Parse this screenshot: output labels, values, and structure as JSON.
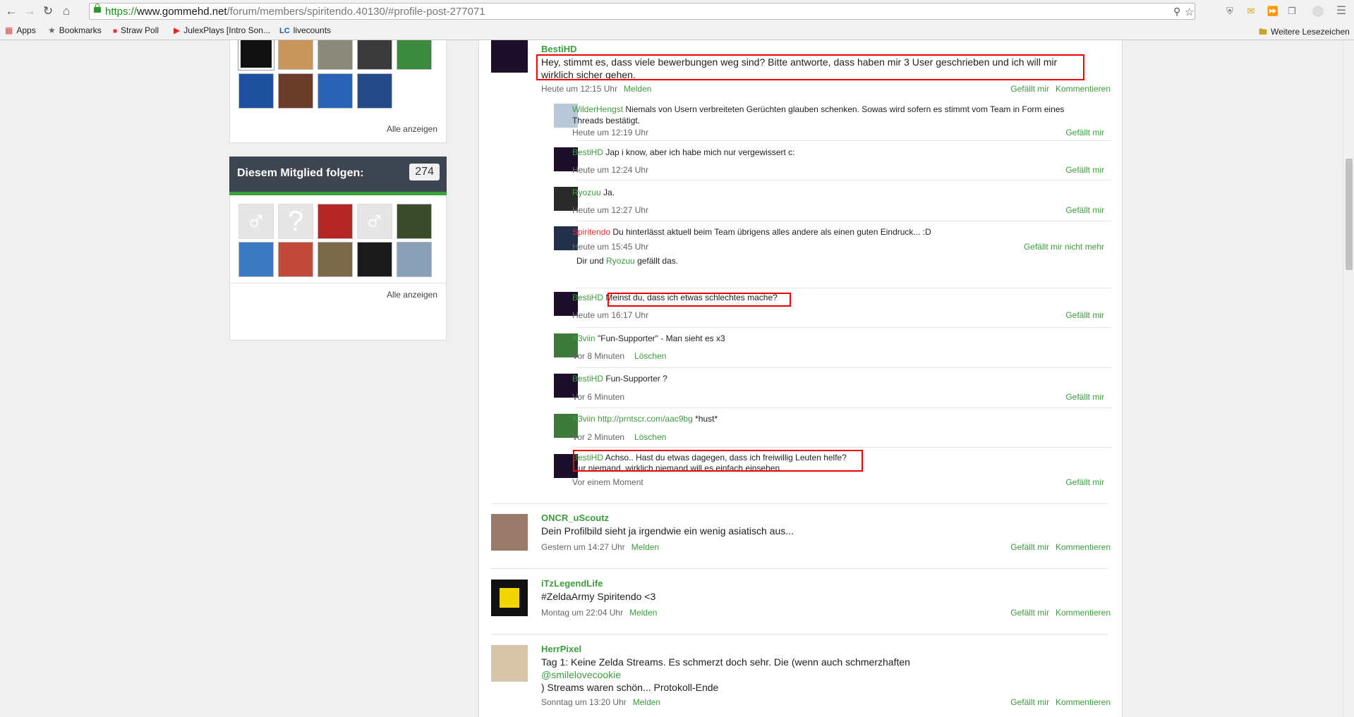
{
  "browser": {
    "url_scheme": "https://",
    "url_host": "www.gommehd.net",
    "url_path": "/forum/members/spiritendo.40130/#profile-post-277071",
    "bookmarks": [
      {
        "label": "Apps",
        "icon": "apps-grid-icon"
      },
      {
        "label": "Bookmarks",
        "icon": "star-icon"
      },
      {
        "label": "Straw Poll",
        "icon": "strawpoll-icon"
      },
      {
        "label": "JulexPlays [Intro Son...",
        "icon": "youtube-icon"
      },
      {
        "label": "livecounts",
        "icon": "lc-icon"
      }
    ],
    "other_bookmarks": "Weitere Lesezeichen"
  },
  "sidebar": {
    "show_all_1": "Alle anzeigen",
    "follow_title": "Diesem Mitglied folgen:",
    "follow_count": "274",
    "show_all_2": "Alle anzeigen"
  },
  "main_post": {
    "author": "BestiHD",
    "text_line1": "Hey, stimmt es, dass viele bewerbungen weg sind? Bitte antworte, dass haben mir 3 User geschrieben und ich will mir",
    "text_line2": "wirklich sicher gehen.",
    "time": "Heute um 12:15 Uhr",
    "report": "Melden",
    "like": "Gefällt mir",
    "comment": "Kommentieren"
  },
  "comments": [
    {
      "author": "WilderHengst",
      "text1": "Niemals von Usern verbreiteten Gerüchten glauben schenken. Sowas wird sofern es stimmt vom Team in Form eines",
      "text2": "Threads bestätigt.",
      "time": "Heute um 12:19 Uhr",
      "action": "",
      "like": "Gefällt mir"
    },
    {
      "author": "BestiHD",
      "text1": "Jap i know, aber ich habe mich nur vergewissert c:",
      "text2": "",
      "time": "Heute um 12:24 Uhr",
      "action": "",
      "like": "Gefällt mir"
    },
    {
      "author": "Ryozuu",
      "text1": "Ja.",
      "text2": "",
      "time": "Heute um 12:27 Uhr",
      "action": "",
      "like": "Gefällt mir"
    },
    {
      "author": "Spiritendo",
      "text1": "Du hinterlässt aktuell beim Team übrigens alles andere als einen guten Eindruck... :D",
      "text2": "",
      "time": "Heute um 15:45 Uhr",
      "action": "",
      "like": "Gefällt mir nicht mehr",
      "likes_pre": "Dir und",
      "likes_user": "Ryozuu",
      "likes_post": "gefällt das."
    },
    {
      "author": "BestiHD",
      "text1": "Meinst du, dass ich etwas schlechtes mache?",
      "text2": "",
      "time": "Heute um 16:17 Uhr",
      "action": "",
      "like": "Gefällt mir"
    },
    {
      "author": "K3viin",
      "text1": "\"Fun-Supporter\" - Man sieht es x3",
      "text2": "",
      "time": "Vor 8 Minuten",
      "action": "Löschen",
      "like": ""
    },
    {
      "author": "BestiHD",
      "text1": "Fun-Supporter ?",
      "text2": "",
      "time": "Vor 6 Minuten",
      "action": "",
      "like": "Gefällt mir"
    },
    {
      "author": "K3viin",
      "text1_link": "http://prntscr.com/aac9bg",
      "text1": "*hust*",
      "text2": "",
      "time": "Vor 2 Minuten",
      "action": "Löschen",
      "like": ""
    },
    {
      "author": "BestiHD",
      "text1": "Achso.. Hast du etwas dagegen, dass ich freiwillig Leuten helfe?",
      "text2": "Nur niemand, wirklich niemand will es einfach einsehen...",
      "time": "Vor einem Moment",
      "action": "",
      "like": "Gefällt mir"
    }
  ],
  "posts": [
    {
      "author": "ONCR_uScoutz",
      "text1": "Dein Profilbild sieht ja irgendwie ein wenig asiatisch aus...",
      "time": "Gestern um 14:27 Uhr",
      "report": "Melden",
      "like": "Gefällt mir",
      "comment": "Kommentieren"
    },
    {
      "author": "iTzLegendLife",
      "text1": "#ZeldaArmy Spiritendo <3",
      "time": "Montag um 22:04 Uhr",
      "report": "Melden",
      "like": "Gefällt mir",
      "comment": "Kommentieren"
    },
    {
      "author": "HerrPixel",
      "text1": "Tag 1: Keine Zelda Streams. Es schmerzt doch sehr. Die (wenn auch schmerzhaften",
      "mention": "@smilelovecookie",
      "text3": ") Streams waren schön... Protokoll-Ende",
      "time": "Sonntag um 13:20 Uhr",
      "report": "Melden",
      "like": "Gefällt mir",
      "comment": "Kommentieren"
    }
  ]
}
